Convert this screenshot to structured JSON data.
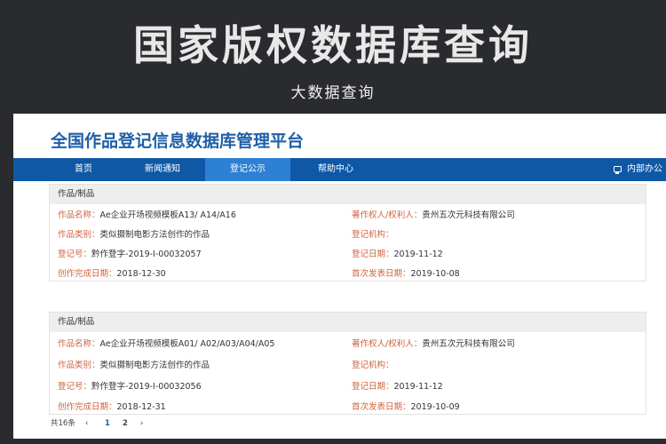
{
  "banner": {
    "title": "国家版权数据库查询",
    "subtitle": "大数据查询"
  },
  "platform_title": "全国作品登记信息数据库管理平台",
  "nav": {
    "items": [
      "首页",
      "新闻通知",
      "登记公示",
      "帮助中心"
    ],
    "active_index": 2,
    "right_label": "内部办公"
  },
  "records": [
    {
      "header": "作品/制品",
      "work_name_label": "作品名称：",
      "work_name": "Ae企业开场视频模板A13/ A14/A16",
      "owner_label": "著作权人/权利人：",
      "owner": "贵州五次元科技有限公司",
      "category_label": "作品类别：",
      "category": "类似摄制电影方法创作的作品",
      "agency_label": "登记机构：",
      "agency": "",
      "reg_no_label": "登记号：",
      "reg_no": "黔作登字-2019-I-00032057",
      "reg_date_label": "登记日期：",
      "reg_date": "2019-11-12",
      "created_label": "创作完成日期：",
      "created": "2018-12-30",
      "published_label": "首次发表日期：",
      "published": "2019-10-08"
    },
    {
      "header": "作品/制品",
      "work_name_label": "作品名称：",
      "work_name": "Ae企业开场视频模板A01/ A02/A03/A04/A05",
      "owner_label": "著作权人/权利人：",
      "owner": "贵州五次元科技有限公司",
      "category_label": "作品类别：",
      "category": "类似摄制电影方法创作的作品",
      "agency_label": "登记机构：",
      "agency": "",
      "reg_no_label": "登记号：",
      "reg_no": "黔作登字-2019-I-00032056",
      "reg_date_label": "登记日期：",
      "reg_date": "2019-11-12",
      "created_label": "创作完成日期：",
      "created": "2018-12-31",
      "published_label": "首次发表日期：",
      "published": "2019-10-09"
    }
  ],
  "pagination": {
    "total": "共16条",
    "prev": "‹",
    "page1": "1",
    "page2": "2",
    "next": "›"
  },
  "colors": {
    "background": "#2a2b2f",
    "nav": "#0f58a6",
    "nav_active": "#2d80d4",
    "title_blue": "#1f5fa8",
    "label_orange": "#d0633f"
  }
}
